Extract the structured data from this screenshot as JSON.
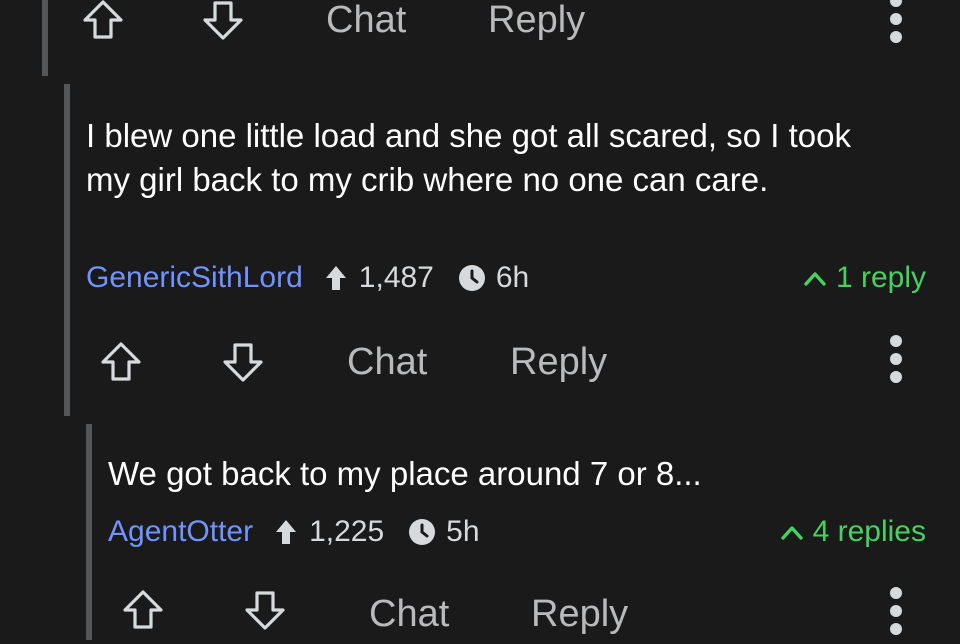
{
  "colors": {
    "background": "#1a1a1b",
    "text": "#ffffff",
    "action_text": "#b8babc",
    "author": "#7193ff",
    "replies": "#46d160",
    "thread_line": "#555658"
  },
  "icons": [
    "upvote-icon",
    "downvote-icon",
    "more-options-icon",
    "score-arrow-icon",
    "clock-icon",
    "chevron-up-icon"
  ],
  "top_actions": {
    "chat_label": "Chat",
    "reply_label": "Reply"
  },
  "comments": [
    {
      "body": "I blew one little load and she got all scared, so I took my girl back to my crib where no one can care.",
      "author": "GenericSithLord",
      "score": "1,487",
      "age": "6h",
      "replies_label": "1 reply",
      "actions": {
        "chat_label": "Chat",
        "reply_label": "Reply"
      }
    },
    {
      "body": "We got back to my place around 7 or 8...",
      "author": "AgentOtter",
      "score": "1,225",
      "age": "5h",
      "replies_label": "4 replies",
      "actions": {
        "chat_label": "Chat",
        "reply_label": "Reply"
      }
    }
  ]
}
